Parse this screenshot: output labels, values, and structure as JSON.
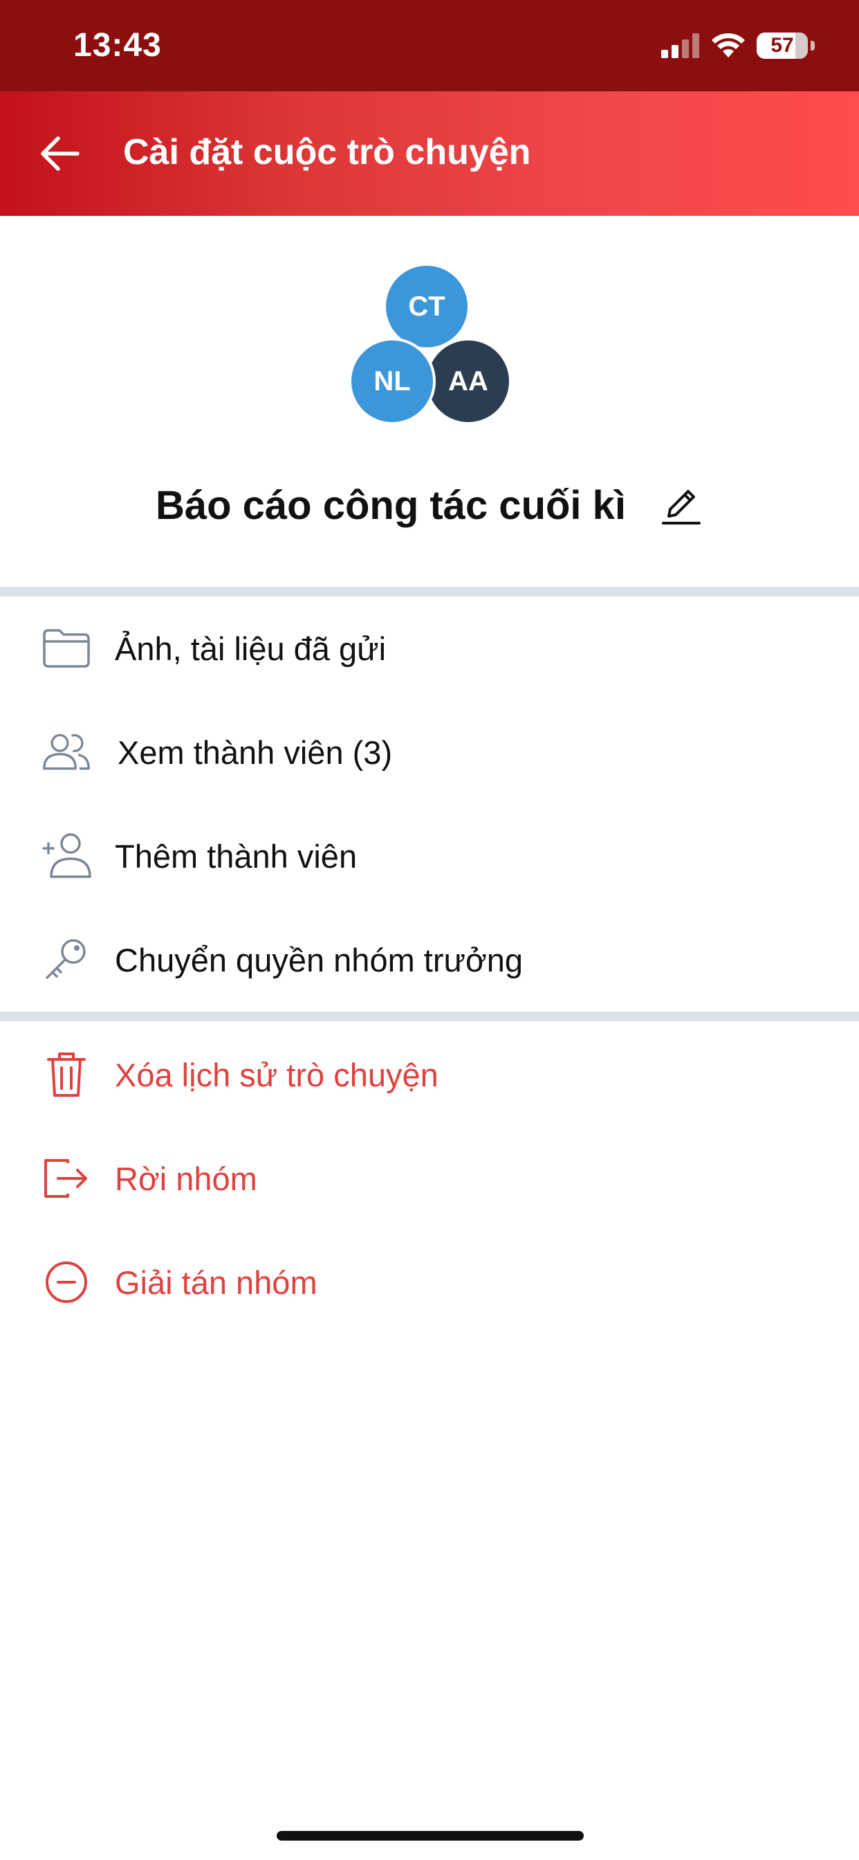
{
  "status_bar": {
    "time": "13:43",
    "battery": "57",
    "icons": [
      "signal-icon",
      "wifi-icon",
      "battery-icon"
    ]
  },
  "header": {
    "title": "Cài đặt cuộc trò chuyện",
    "back_icon": "arrow-left-icon",
    "background_color": "#d8262b"
  },
  "group": {
    "avatars": [
      {
        "initials": "CT",
        "color": "#3b97d9"
      },
      {
        "initials": "NL",
        "color": "#3b97d9"
      },
      {
        "initials": "AA",
        "color": "#2c3d51"
      }
    ],
    "name": "Báo cáo công tác cuối kì",
    "edit_icon": "pencil-icon"
  },
  "menu": {
    "items": [
      {
        "label": "Ảnh, tài liệu đã gửi",
        "icon": "folder-icon"
      },
      {
        "label": "Xem thành viên (3)",
        "icon": "users-icon"
      },
      {
        "label": "Thêm thành viên",
        "icon": "add-user-icon"
      },
      {
        "label": "Chuyển quyền nhóm trưởng",
        "icon": "key-icon"
      }
    ],
    "danger_items": [
      {
        "label": "Xóa lịch sử trò chuyện",
        "icon": "trash-icon"
      },
      {
        "label": "Rời nhóm",
        "icon": "logout-icon"
      },
      {
        "label": "Giải tán nhóm",
        "icon": "minus-circle-icon"
      }
    ]
  },
  "colors": {
    "danger": "#e0413f",
    "icon_gray": "#7c8696",
    "divider": "#dce1ea",
    "status_bar": "#8b0f0e"
  }
}
